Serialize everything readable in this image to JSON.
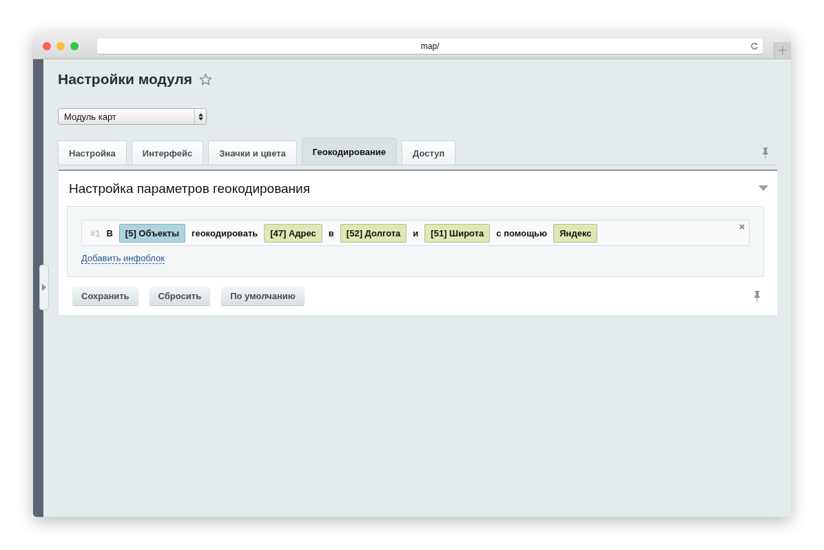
{
  "browser": {
    "url": "map/"
  },
  "page": {
    "title": "Настройки модуля",
    "favorite": false
  },
  "module_select": {
    "value": "Модуль карт"
  },
  "tabs": [
    {
      "label": "Настройка",
      "selected": false
    },
    {
      "label": "Интерфейс",
      "selected": false
    },
    {
      "label": "Значки и цвета",
      "selected": false
    },
    {
      "label": "Геокодирование",
      "selected": true
    },
    {
      "label": "Доступ",
      "selected": false
    }
  ],
  "section": {
    "title": "Настройка параметров геокодирования",
    "expanded": true
  },
  "rules": [
    {
      "number": "#1",
      "parts": [
        {
          "kind": "text",
          "text": "В"
        },
        {
          "kind": "chip",
          "text": "[5] Объекты",
          "color": "#add3e0"
        },
        {
          "kind": "text",
          "text": "геокодировать"
        },
        {
          "kind": "chip",
          "text": "[47] Адрес",
          "color": "#dfe8b4"
        },
        {
          "kind": "text",
          "text": "в"
        },
        {
          "kind": "chip",
          "text": "[52] Долгота",
          "color": "#dfe8b4"
        },
        {
          "kind": "text",
          "text": "и"
        },
        {
          "kind": "chip",
          "text": "[51] Широта",
          "color": "#dfe8b4"
        },
        {
          "kind": "text",
          "text": "с помощью"
        },
        {
          "kind": "chip",
          "text": "Яндекс",
          "color": "#dfe8b4"
        }
      ]
    }
  ],
  "add_link": "Добавить инфоблок",
  "buttons": [
    "Сохранить",
    "Сбросить",
    "По умолчанию"
  ]
}
